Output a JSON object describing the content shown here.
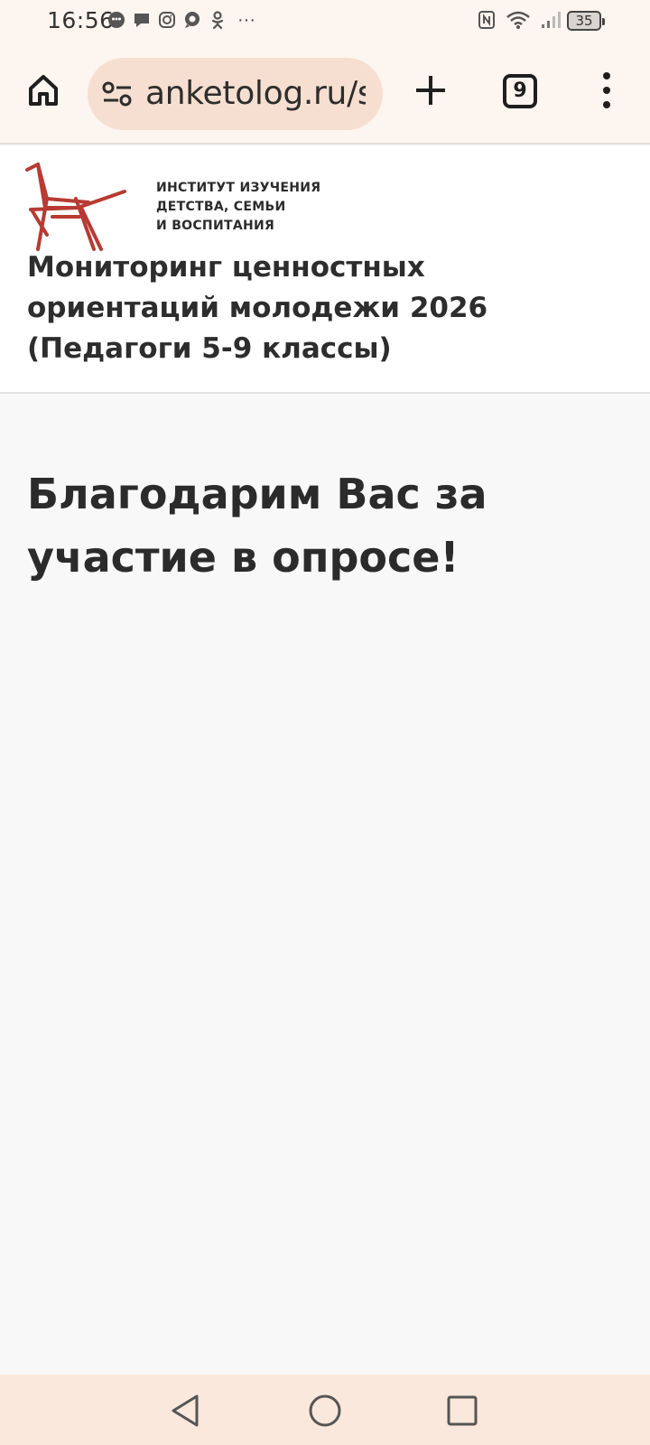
{
  "status_bar": {
    "time": "16:56",
    "app_icons": [
      "chat-bubble-icon",
      "message-icon",
      "instagram-icon",
      "chat-icon",
      "odnoklassniki-icon"
    ],
    "more": "···",
    "system_icons": [
      "nfc-icon",
      "wifi-icon",
      "signal-icon",
      "signal-icon"
    ],
    "battery": "35"
  },
  "browser": {
    "url": "anketolog.ru/su",
    "tab_count": "9",
    "accent_color": "#f6dfd0"
  },
  "header": {
    "org_name_lines": [
      "ИНСТИТУТ ИЗУЧЕНИЯ",
      "ДЕТСТВА, СЕМЬИ",
      "И ВОСПИТАНИЯ"
    ],
    "survey_title": "Мониторинг ценностных ориентаций молодежи 2026 (Педагоги 5-9 классы)",
    "logo_color": "#b83a32"
  },
  "main": {
    "thanks_text": "Благодарим Вас за участие в опросе!"
  },
  "nav": {
    "buttons": [
      "back-icon",
      "home-circle-icon",
      "recents-icon"
    ]
  }
}
